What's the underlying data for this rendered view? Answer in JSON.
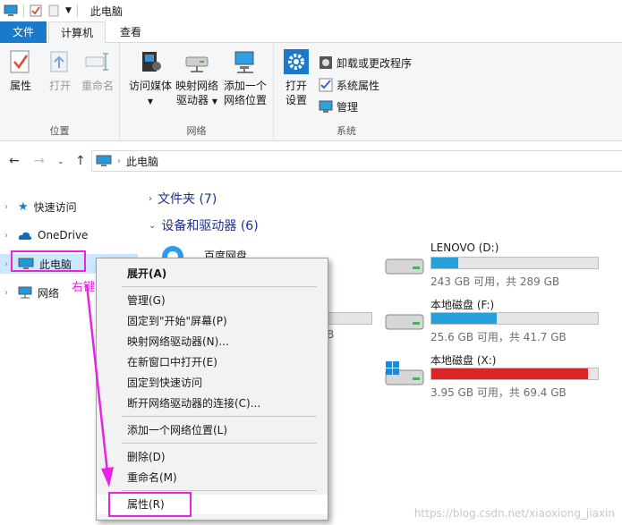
{
  "window": {
    "title": "此电脑"
  },
  "tabs": [
    {
      "label": "文件"
    },
    {
      "label": "计算机"
    },
    {
      "label": "查看"
    }
  ],
  "ribbon": {
    "location": {
      "label": "位置",
      "properties": "属性",
      "open": "打开",
      "rename": "重命名"
    },
    "network": {
      "label": "网络",
      "access_media": "访问媒体",
      "map_drive_1": "映射网络",
      "map_drive_2": "驱动器",
      "add_location_1": "添加一个",
      "add_location_2": "网络位置"
    },
    "system": {
      "label": "系统",
      "open_settings_1": "打开",
      "open_settings_2": "设置",
      "uninstall": "卸载或更改程序",
      "system_properties": "系统属性",
      "manage": "管理"
    }
  },
  "address": {
    "path": "此电脑"
  },
  "nav": {
    "quick_access": "快速访问",
    "onedrive": "OneDrive",
    "this_pc": "此电脑",
    "network": "网络"
  },
  "main": {
    "folders_section": "文件夹 (7)",
    "devices_section": "设备和驱动器 (6)",
    "baidu_label": "百度网盘",
    "partial_info": "B",
    "drives": [
      {
        "name": "LENOVO (D:)",
        "info": "243 GB 可用，共 289 GB",
        "used_fraction": 0.16,
        "color": "#26a0da"
      },
      {
        "name": "本地磁盘 (F:)",
        "info": "25.6 GB 可用，共 41.7 GB",
        "used_fraction": 0.39,
        "color": "#26a0da"
      },
      {
        "name": "本地磁盘 (X:)",
        "info": "3.95 GB 可用，共 69.4 GB",
        "used_fraction": 0.94,
        "color": "#da2626"
      }
    ]
  },
  "context_menu": {
    "items": [
      {
        "label": "展开(A)",
        "bold": true
      },
      {
        "label": "管理(G)"
      },
      {
        "label": "固定到\"开始\"屏幕(P)"
      },
      {
        "label": "映射网络驱动器(N)..."
      },
      {
        "label": "在新窗口中打开(E)"
      },
      {
        "label": "固定到快速访问"
      },
      {
        "label": "断开网络驱动器的连接(C)..."
      },
      {
        "label": "添加一个网络位置(L)"
      },
      {
        "label": "删除(D)"
      },
      {
        "label": "重命名(M)"
      },
      {
        "label": "属性(R)"
      }
    ]
  },
  "annotation": {
    "text": "右键",
    "color": "#e624e6"
  },
  "watermark": "https://blog.csdn.net/xiaoxiong_jiaxin"
}
